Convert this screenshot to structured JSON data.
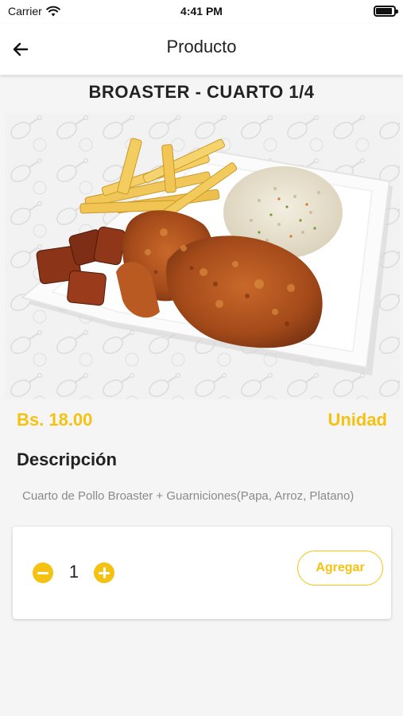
{
  "status_bar": {
    "carrier": "Carrier",
    "time": "4:41 PM",
    "wifi_icon": "wifi-icon",
    "battery_icon": "battery-icon"
  },
  "header": {
    "title": "Producto",
    "back_icon": "arrow-left-icon"
  },
  "product": {
    "name": "BROASTER - CUARTO 1/4",
    "image_description": "plate-of-broaster-chicken-fries-rice-plantain",
    "price": "Bs. 18.00",
    "unit": "Unidad",
    "description_heading": "Descripción",
    "description": "Cuarto de Pollo Broaster + Guarniciones(Papa, Arroz, Platano)"
  },
  "cart": {
    "quantity": "1",
    "minus_icon": "minus-circle-icon",
    "plus_icon": "plus-circle-icon",
    "add_label": "Agregar"
  },
  "colors": {
    "accent": "#f5c211",
    "background": "#f5f5f5",
    "text": "#222222",
    "muted": "#8a8a8a"
  }
}
